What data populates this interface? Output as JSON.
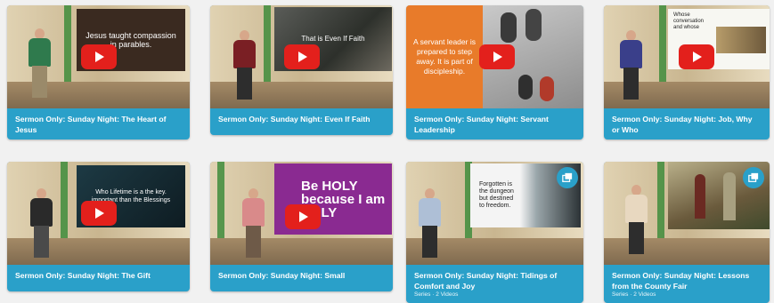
{
  "cards": [
    {
      "title": "Sermon Only: Sunday Night: The Heart of Jesus",
      "screen_text": "Jesus taught compassion in parables."
    },
    {
      "title": "Sermon Only: Sunday Night: Even If Faith",
      "screen_text": "That is Even If Faith"
    },
    {
      "title": "Sermon Only: Sunday Night: Servant Leadership",
      "screen_text": "A servant leader is prepared to step away. It is part of discipleship."
    },
    {
      "title": "Sermon Only: Sunday Night: Job, Why or Who",
      "screen_text": "Whose conversation and whose"
    },
    {
      "title": "Sermon Only: Sunday Night: The Gift",
      "screen_text": "Who Lifetime is a the key. important than the Blessings"
    },
    {
      "title": "Sermon Only: Sunday Night: Small",
      "screen_text": "Be HOLY because I am HOLY"
    },
    {
      "title": "Sermon Only: Sunday Night: Tidings of Comfort and Joy",
      "subtitle": "Series · 2 Videos",
      "screen_text": "Forgotten is the dungeon but destined to freedom."
    },
    {
      "title": "Sermon Only: Sunday Night: Lessons from the County Fair",
      "subtitle": "Series · 2 Videos",
      "screen_text": ""
    }
  ],
  "icons": {
    "play": "play-icon",
    "series": "stack-icon"
  },
  "colors": {
    "caption_bg": "#2aa0c9",
    "play_button": "#e3201c",
    "orange_slide": "#e87b2a",
    "holy_slide": "#8a2a91"
  }
}
